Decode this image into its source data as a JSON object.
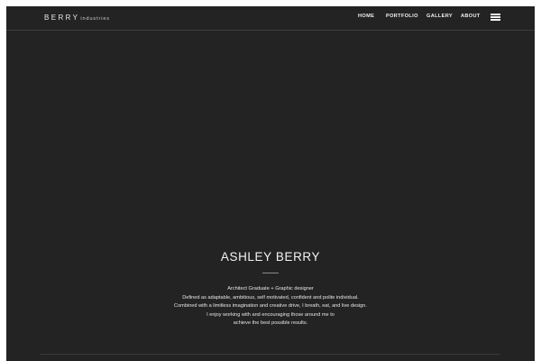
{
  "header": {
    "logo": {
      "main": "BERRY",
      "sub": "industries"
    },
    "nav": [
      {
        "label": "HOME"
      },
      {
        "label": "PORTFOLIO"
      },
      {
        "label": "GALLERY"
      },
      {
        "label": "ABOUT"
      }
    ],
    "menu_icon": "hamburger-menu-icon"
  },
  "hero": {
    "name": "ASHLEY BERRY",
    "bio_lines": [
      "Architect Graduate + Graphic designer",
      "Defined as adaptable, ambitious, self motivated, confident and polite individual.",
      "Combined with a limitless imagination and creative drive, I breath, eat, and live design.",
      "I enjoy working with and encouraging those around me to",
      "achieve the best possible results."
    ]
  },
  "colors": {
    "background": "#232323",
    "page_border": "#ffffff",
    "text": "#f2f2f2",
    "divider": "#3c3c3c"
  }
}
